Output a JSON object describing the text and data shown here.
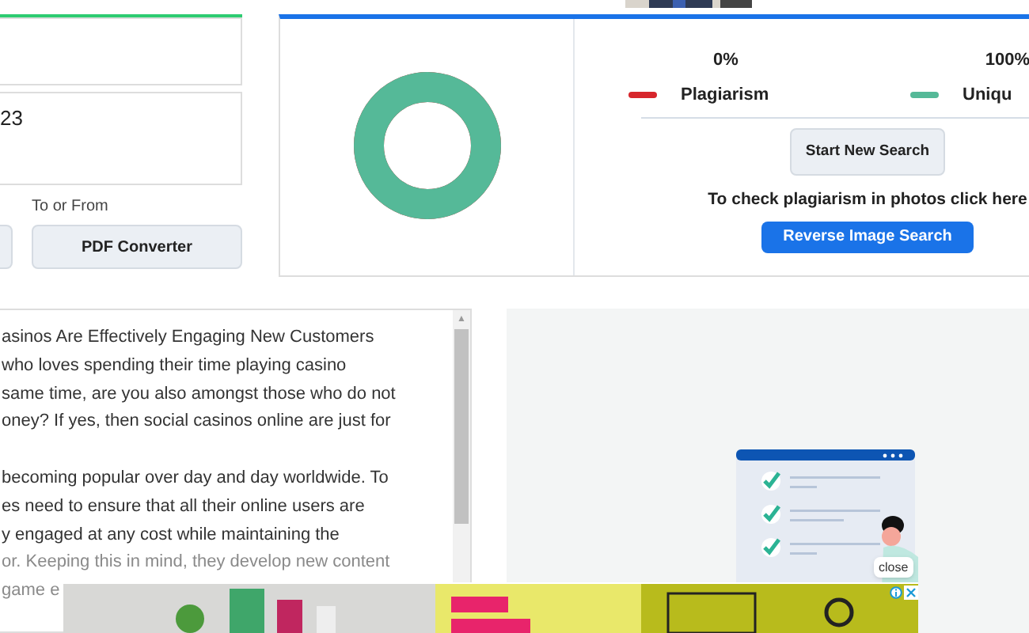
{
  "input_panel": {
    "field_value": "23",
    "converter_label": "To or From",
    "button_label": "PDF Converter"
  },
  "result_card": {
    "stats": [
      {
        "percent": "0%",
        "label": "Plagiarism",
        "color": "#d7262c"
      },
      {
        "percent": "100%",
        "label": "Uniqu",
        "color": "#55b998"
      }
    ],
    "unique_chart": {
      "level": 1
    },
    "new_search_button": "Start New Search",
    "photo_hint": "To check plagiarism in photos click here",
    "reverse_button": "Reverse Image Search"
  },
  "text_area": {
    "paragraphs": [
      [
        "asinos Are Effectively Engaging New Customers",
        "who loves spending their time playing casino",
        "same time, are you also amongst those who do not",
        "oney? If yes, then social casinos online are just for"
      ],
      [
        "becoming popular over day and day worldwide. To",
        "es need to ensure that all their online users are",
        "y engaged at any cost while maintaining the"
      ]
    ],
    "faded_lines": [
      "or. Keeping this in mind, they develop new content",
      "game e"
    ]
  },
  "ad": {
    "close_label": "close"
  },
  "scroll_up_arrow": "▲"
}
